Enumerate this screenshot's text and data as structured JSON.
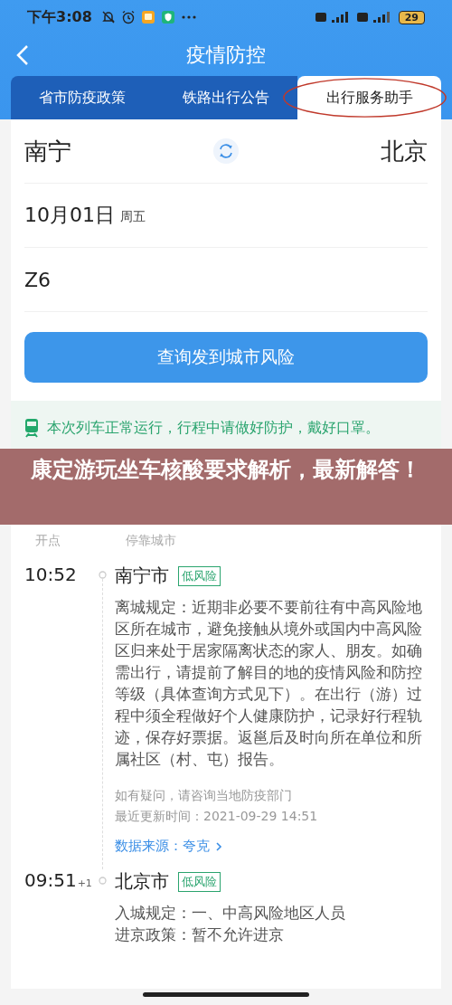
{
  "status_bar": {
    "time": "下午3:08",
    "battery": "29"
  },
  "nav": {
    "title": "疫情防控"
  },
  "tabs": [
    {
      "label": "省市防疫政策",
      "selected": false
    },
    {
      "label": "铁路出行公告",
      "selected": false
    },
    {
      "label": "出行服务助手",
      "selected": true
    }
  ],
  "trip": {
    "from": "南宁",
    "to": "北京",
    "date": "10月01日",
    "weekday": "周五",
    "train": "Z6"
  },
  "query_button": "查询发到城市风险",
  "notice": "本次列车正常运行，行程中请做好防护，戴好口罩。",
  "banner": "康定游玩坐车核酸要求解析，最新解答！",
  "columns": [
    "开点",
    "停靠城市"
  ],
  "stops": [
    {
      "time": "10:52",
      "city": "南宁市",
      "risk": "低风险",
      "rules": [
        "离城规定：近期非必要不要前往有中高风险地区所在城市，避免接触从境外或国内中高风险区归来处于居家隔离状态的家人、朋友。如确需出行，请提前了解目的地的疫情风险和防控等级（具体查询方式见下）。在出行（游）过程中须全程做好个人健康防护，记录好行程轨迹，保存好票据。返邕后及时向所在单位和所属社区（村、屯）报告。"
      ],
      "notes": [
        "如有疑问，请咨询当地防疫部门",
        "最近更新时间：2021-09-29 14:51"
      ],
      "source": "数据来源：夸克"
    },
    {
      "time": "09:51",
      "day_offset": "+1",
      "city": "北京市",
      "risk": "低风险",
      "rules": [
        "入城规定：一、中高风险地区人员",
        "进京政策：暂不允许进京"
      ]
    }
  ]
}
